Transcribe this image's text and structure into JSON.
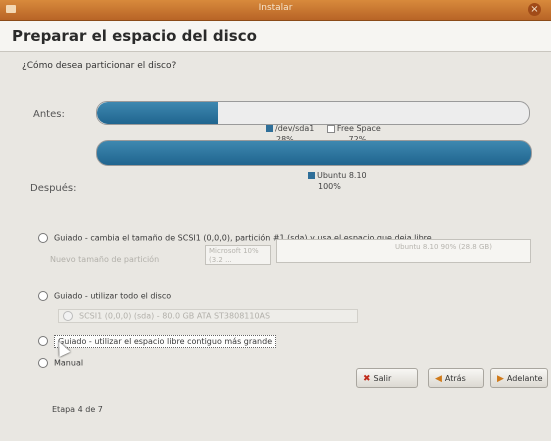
{
  "window": {
    "title": "Instalar"
  },
  "header": {
    "title": "Preparar el espacio del disco"
  },
  "question": "¿Cómo desea particionar el disco?",
  "before": {
    "label": "Antes:",
    "usage_fraction": 0.28,
    "legend": [
      {
        "name": "/dev/sda1",
        "percent": "28%"
      },
      {
        "name": "Free Space",
        "percent": "72%"
      }
    ]
  },
  "after": {
    "label": "Después:",
    "usage_fraction": 1.0,
    "legend": [
      {
        "name": "Ubuntu 8.10",
        "percent": "100%"
      }
    ]
  },
  "options": [
    {
      "label": "Guiado - cambia el tamaño de SCSI1 (0,0,0), partición #1 (sda) y usa el espacio que deja libre"
    },
    {
      "label": "Guiado - utilizar todo el disco"
    },
    {
      "label": "Guiado - utilizar el espacio libre contiguo más grande"
    },
    {
      "label": "Manual"
    }
  ],
  "resize": {
    "label": "Nuevo tamaño de partición",
    "left_box": "Microsoft 10% (3.2 ...",
    "right_box": "Ubuntu 8.10 90% (28.8 GB)"
  },
  "disk_select": "SCSI1 (0,0,0) (sda) - 80.0 GB ATA ST3808110AS",
  "buttons": {
    "salir": "Salir",
    "atras": "Atrás",
    "adelante": "Adelante"
  },
  "stage": "Etapa 4 de 7",
  "colors": {
    "titlebar": "#c8742e",
    "bar_fill": "#2f6f99"
  }
}
